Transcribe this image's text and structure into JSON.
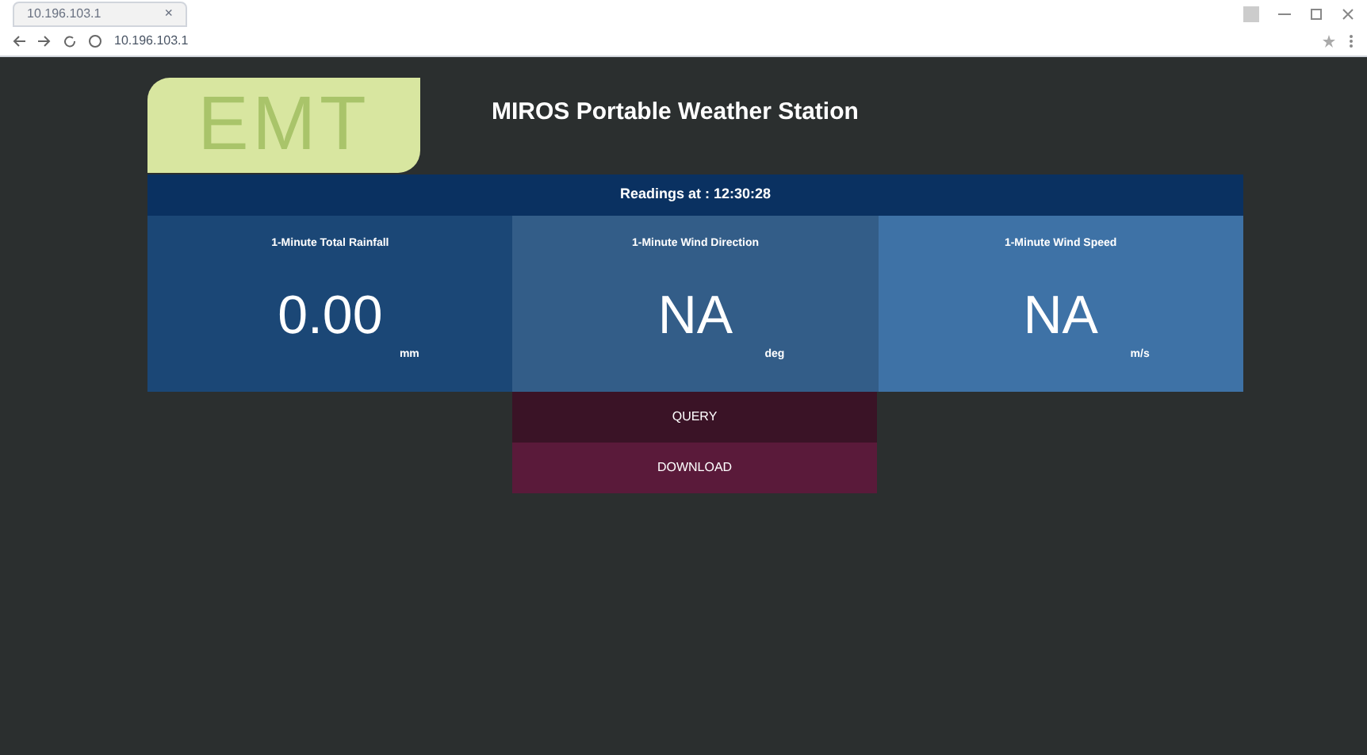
{
  "browser": {
    "tab_title": "10.196.103.1",
    "close_tab": "×",
    "address": "10.196.103.1"
  },
  "logo": {
    "text": "EMT"
  },
  "title": "MIROS Portable Weather Station",
  "readings_bar": "Readings at : 12:30:28",
  "tiles": [
    {
      "label": "1-Minute Total Rainfall",
      "value": "0.00",
      "unit": "mm",
      "color": "#1b4776"
    },
    {
      "label": "1-Minute Wind Direction",
      "value": "NA",
      "unit": "deg",
      "color": "#335d88"
    },
    {
      "label": "1-Minute Wind Speed",
      "value": "NA",
      "unit": "m/s",
      "color": "#3e72a6"
    }
  ],
  "buttons": [
    {
      "label": "QUERY",
      "color": "#3a1326"
    },
    {
      "label": "DOWNLOAD",
      "color": "#5a1a3a"
    }
  ]
}
